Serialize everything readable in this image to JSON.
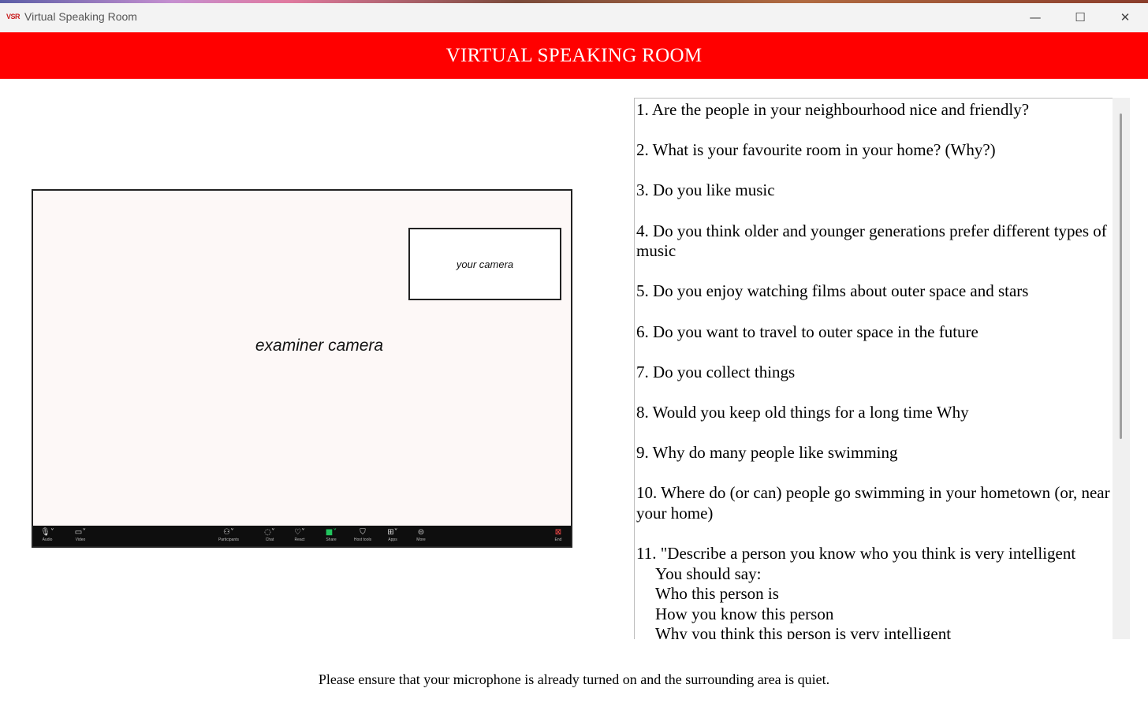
{
  "window": {
    "app_icon_text": "VSR",
    "title": "Virtual Speaking Room",
    "controls": {
      "minimize": "—",
      "maximize": "☐",
      "close": "✕"
    }
  },
  "header": {
    "title": "VIRTUAL SPEAKING ROOM",
    "background_color": "#ff0000"
  },
  "video": {
    "examiner_label": "examiner camera",
    "self_label": "your camera",
    "toolbar": [
      {
        "label": "Audio",
        "icon": "mic-icon"
      },
      {
        "label": "Video",
        "icon": "video-camera-icon"
      },
      {
        "label": "Participants",
        "icon": "participants-icon"
      },
      {
        "label": "Chat",
        "icon": "chat-icon"
      },
      {
        "label": "React",
        "icon": "heart-icon"
      },
      {
        "label": "Share",
        "icon": "share-icon"
      },
      {
        "label": "Host tools",
        "icon": "shield-icon"
      },
      {
        "label": "Apps",
        "icon": "apps-icon"
      },
      {
        "label": "More",
        "icon": "more-icon"
      },
      {
        "label": "End",
        "icon": "end-call-icon"
      }
    ]
  },
  "questions": [
    {
      "text": "1. Are the people in your neighbourhood nice and friendly?"
    },
    {
      "text": "2. What is your favourite room in your home? (Why?)"
    },
    {
      "text": "3. Do you like music"
    },
    {
      "text": "4. Do you think older and younger generations prefer different types of music"
    },
    {
      "text": "5. Do you enjoy watching films about outer space and stars"
    },
    {
      "text": "6. Do you want to travel to outer space in the future"
    },
    {
      "text": "7. Do you collect things"
    },
    {
      "text": "8. Would you keep old things for a long time  Why"
    },
    {
      "text": "9. Why do many people like swimming"
    },
    {
      "text": "10. Where do (or can) people go swimming in your hometown (or, near your home)"
    },
    {
      "text": "11. \"Describe a person you know who you think is very intelligent",
      "sub": [
        "You should say:",
        "Who this person is",
        "How you know this person",
        "Why you think this person is very intelligent"
      ]
    }
  ],
  "footer": {
    "note": "Please ensure that your microphone is already turned on and the surrounding area is quiet."
  }
}
